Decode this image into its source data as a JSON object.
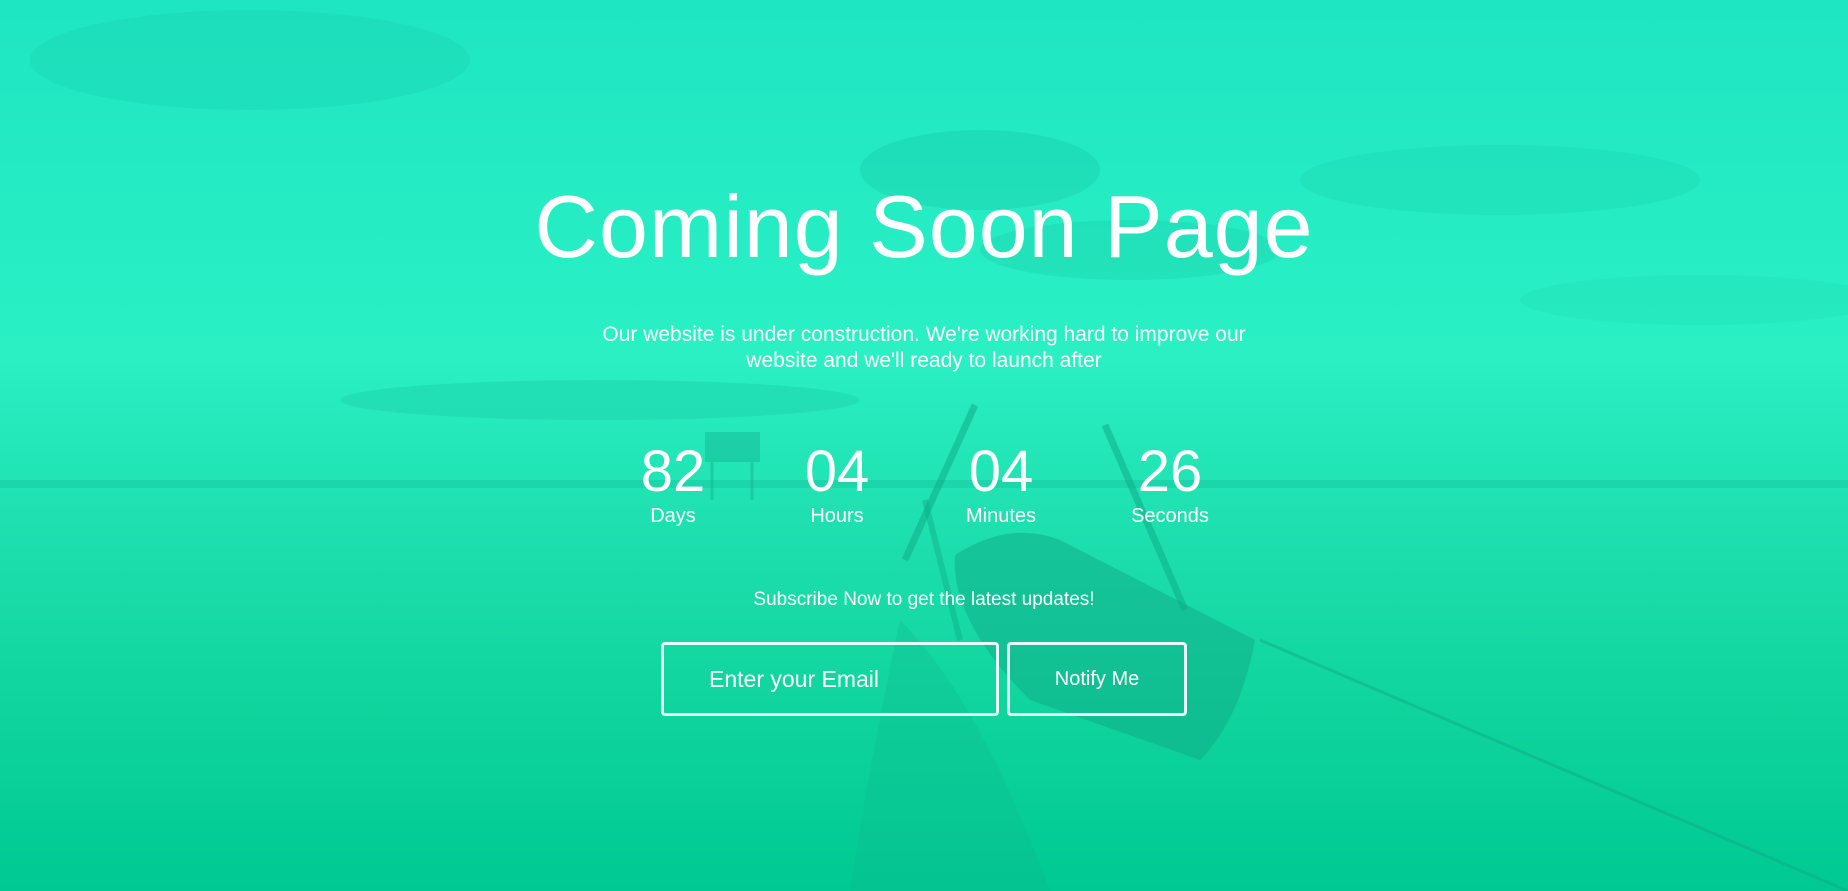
{
  "hero": {
    "title": "Coming Soon Page",
    "subtitle": "Our website is under construction. We're working hard to improve our website and we'll ready to launch after"
  },
  "countdown": {
    "days": {
      "value": "82",
      "label": "Days"
    },
    "hours": {
      "value": "04",
      "label": "Hours"
    },
    "minutes": {
      "value": "04",
      "label": "Minutes"
    },
    "seconds": {
      "value": "26",
      "label": "Seconds"
    }
  },
  "subscribe": {
    "text": "Subscribe Now to get the latest updates!",
    "email_placeholder": "Enter your Email",
    "button_label": "Notify Me"
  },
  "colors": {
    "overlay": "#1ee6c2",
    "text": "#ffffff"
  }
}
